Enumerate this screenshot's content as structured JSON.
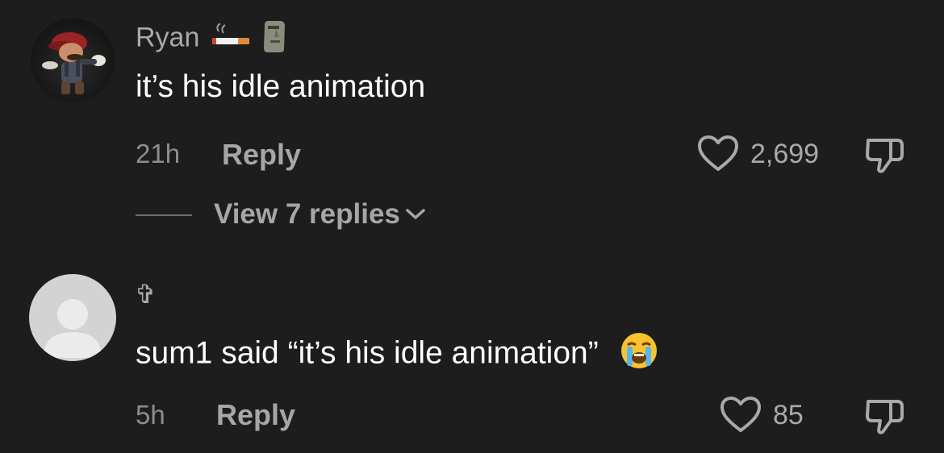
{
  "comments": [
    {
      "username": "Ryan",
      "username_emojis": [
        "cigarette-emoji",
        "moai-emoji"
      ],
      "text": "it’s his idle animation",
      "time": "21h",
      "reply_label": "Reply",
      "likes": "2,699",
      "view_replies_label": "View 7 replies"
    },
    {
      "username": "✞",
      "text": "sum1 said “it’s his idle animation”",
      "text_emoji": "loudly-crying-face-emoji",
      "time": "5h",
      "reply_label": "Reply",
      "likes": "85"
    }
  ],
  "colors": {
    "background": "#1d1d1d",
    "primary_text": "#ffffff",
    "secondary_text": "#a9a9a9",
    "muted_text": "#8e8e8e",
    "default_avatar": "#d3d3d3"
  }
}
